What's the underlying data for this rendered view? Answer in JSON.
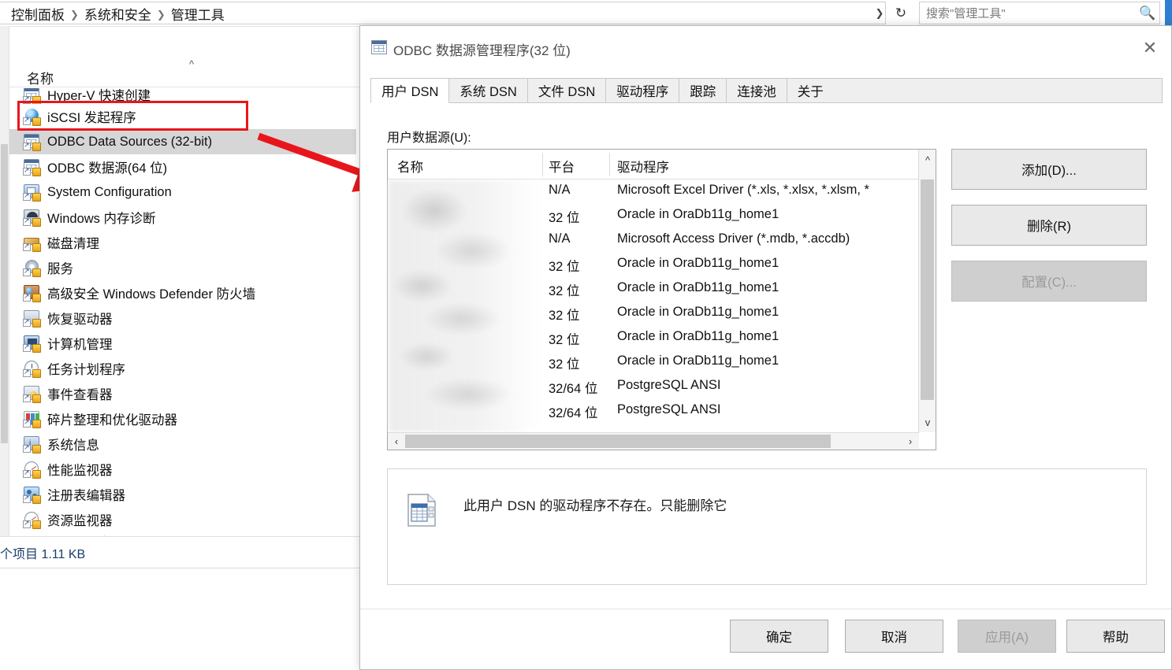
{
  "explorer": {
    "breadcrumb": [
      "控制面板",
      "系统和安全",
      "管理工具"
    ],
    "breadcrumb_separator": "❯",
    "search": {
      "placeholder": "搜索\"管理工具\"",
      "icon": "search-icon"
    },
    "address_chevron_icon": "chevron-down-icon",
    "refresh_icon": "refresh-icon",
    "column_header": "名称",
    "sort_chevron_icon": "chevron-up-icon",
    "items": [
      {
        "label": "Hyper-V 快速创建",
        "icon": "odbc-icon",
        "selected": false,
        "clipped": true
      },
      {
        "label": "iSCSI 发起程序",
        "icon": "globe-icon",
        "selected": false
      },
      {
        "label": "ODBC Data Sources (32-bit)",
        "icon": "odbc-icon",
        "selected": true,
        "highlighted": true
      },
      {
        "label": "ODBC 数据源(64 位)",
        "icon": "odbc-icon",
        "selected": false
      },
      {
        "label": "System Configuration",
        "icon": "sysconf-icon",
        "selected": false
      },
      {
        "label": "Windows 内存诊断",
        "icon": "memory-icon",
        "selected": false
      },
      {
        "label": "磁盘清理",
        "icon": "broom-icon",
        "selected": false
      },
      {
        "label": "服务",
        "icon": "gear-icon",
        "selected": false
      },
      {
        "label": "高级安全 Windows Defender 防火墙",
        "icon": "firewall-icon",
        "selected": false
      },
      {
        "label": "恢复驱动器",
        "icon": "recovery-icon",
        "selected": false
      },
      {
        "label": "计算机管理",
        "icon": "computer-icon",
        "selected": false
      },
      {
        "label": "任务计划程序",
        "icon": "clock-icon",
        "selected": false
      },
      {
        "label": "事件查看器",
        "icon": "event-icon",
        "selected": false
      },
      {
        "label": "碎片整理和优化驱动器",
        "icon": "defrag-icon",
        "selected": false
      },
      {
        "label": "系统信息",
        "icon": "sysinfo-icon",
        "selected": false
      },
      {
        "label": "性能监视器",
        "icon": "perf-icon",
        "selected": false
      },
      {
        "label": "注册表编辑器",
        "icon": "registry-icon",
        "selected": false
      },
      {
        "label": "资源监视器",
        "icon": "perf-icon",
        "selected": false
      },
      {
        "label": "组件服务",
        "icon": "service-icon",
        "selected": false
      }
    ],
    "status": "个项目  1.11 KB"
  },
  "annotation": {
    "highlight_color": "#e8161c",
    "arrow_color": "#e8161c",
    "highlighted_item": "ODBC Data Sources (32-bit)"
  },
  "dialog": {
    "title": "ODBC 数据源管理程序(32 位)",
    "title_icon": "odbc-icon",
    "close_label": "✕",
    "tabs": [
      {
        "label": "用户 DSN",
        "active": true
      },
      {
        "label": "系统 DSN",
        "active": false
      },
      {
        "label": "文件 DSN",
        "active": false
      },
      {
        "label": "驱动程序",
        "active": false
      },
      {
        "label": "跟踪",
        "active": false
      },
      {
        "label": "连接池",
        "active": false
      },
      {
        "label": "关于",
        "active": false
      }
    ],
    "list_label": "用户数据源(U):",
    "columns": [
      "名称",
      "平台",
      "驱动程序"
    ],
    "rows": [
      {
        "name": "",
        "platform": "N/A",
        "driver": "Microsoft Excel Driver (*.xls, *.xlsx, *.xlsm, *"
      },
      {
        "name": "",
        "platform": "32 位",
        "driver": "Oracle in OraDb11g_home1"
      },
      {
        "name": "",
        "platform": "N/A",
        "driver": "Microsoft Access Driver (*.mdb, *.accdb)"
      },
      {
        "name": "",
        "platform": "32 位",
        "driver": "Oracle in OraDb11g_home1"
      },
      {
        "name": "",
        "platform": "32 位",
        "driver": "Oracle in OraDb11g_home1"
      },
      {
        "name": "",
        "platform": "32 位",
        "driver": "Oracle in OraDb11g_home1"
      },
      {
        "name": "",
        "platform": "32 位",
        "driver": "Oracle in OraDb11g_home1"
      },
      {
        "name": "",
        "platform": "32 位",
        "driver": "Oracle in OraDb11g_home1"
      },
      {
        "name": "",
        "platform": "32/64 位",
        "driver": "PostgreSQL ANSI"
      },
      {
        "name": "",
        "platform": "32/64 位",
        "driver": "PostgreSQL ANSI"
      }
    ],
    "scroll": {
      "v_up_icon": "chevron-up-icon",
      "v_down_icon": "chevron-down-icon",
      "h_left_icon": "chevron-left-icon",
      "h_right_icon": "chevron-right-icon"
    },
    "side_buttons": [
      {
        "label": "添加(D)...",
        "disabled": false
      },
      {
        "label": "删除(R)",
        "disabled": false
      },
      {
        "label": "配置(C)...",
        "disabled": true
      }
    ],
    "description": {
      "icon": "dsn-file-icon",
      "text": "此用户 DSN 的驱动程序不存在。只能删除它"
    },
    "footer_buttons": [
      {
        "label": "确定",
        "disabled": false
      },
      {
        "label": "取消",
        "disabled": false
      },
      {
        "label": "应用(A)",
        "disabled": true
      },
      {
        "label": "帮助",
        "disabled": false
      }
    ]
  }
}
